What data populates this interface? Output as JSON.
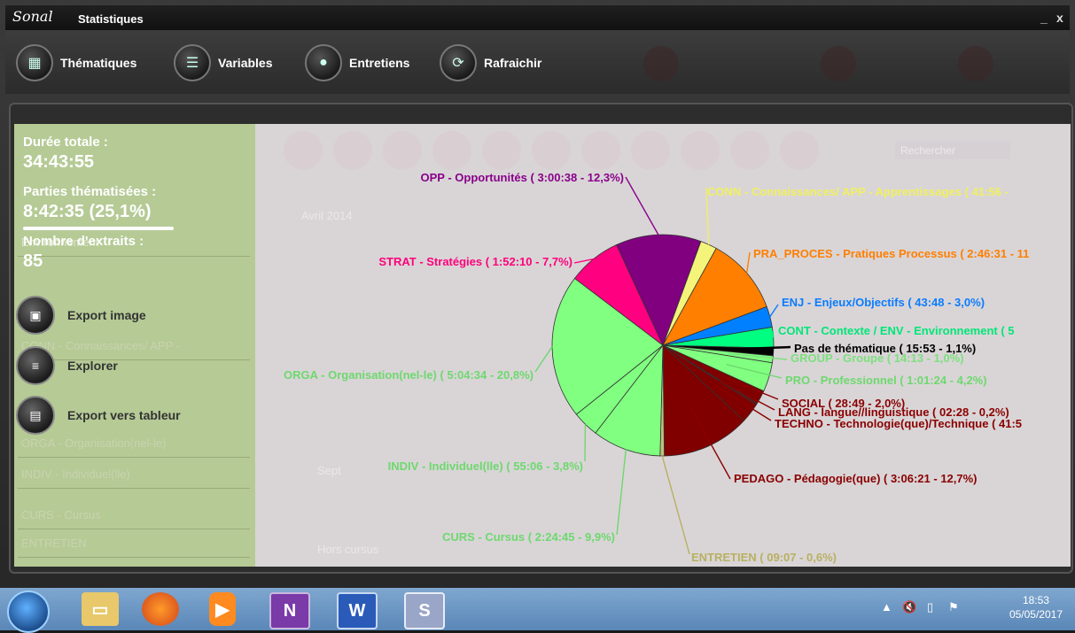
{
  "app": {
    "logo": "Sonal",
    "title": "Statistiques",
    "minimize": "_",
    "close": "x"
  },
  "toolbar": {
    "thematiques": "Thématiques",
    "variables": "Variables",
    "entretiens": "Entretiens",
    "rafraichir": "Rafraichir"
  },
  "stats": {
    "duree_label": "Durée totale :",
    "duree_value": "34:43:55",
    "parties_label": "Parties thématisées :",
    "parties_value": "8:42:35 (25,1%)",
    "extraits_label": "Nombre d'extraits :",
    "extraits_value": "85"
  },
  "actions": {
    "export_image": "Export image",
    "explorer": "Explorer",
    "export_tableur": "Export vers tableur"
  },
  "background_list": {
    "items": [
      "Environnement",
      "CONN - Connaissances/ APP -",
      "ORGA - Organisation(nel-le)",
      "INDIV - Individuel(lle)",
      "CURS - Cursus",
      "ENTRETIEN"
    ],
    "right_items": [
      "Avril 2014",
      "Sept",
      "Hors cursus",
      "Rechercher"
    ]
  },
  "chart_data": {
    "type": "pie",
    "slices": [
      {
        "label": "CONN - Connaissances/ APP - Apprentissages ( 41:56 -",
        "pct": 2.4,
        "color": "#f4f47a",
        "textcolor": "#f0f060"
      },
      {
        "label": "PRA_PROCES - Pratiques Processus ( 2:46:31 - 11",
        "pct": 11.2,
        "color": "#ff8000",
        "textcolor": "#ff7f00"
      },
      {
        "label": "ENJ - Enjeux/Objectifs ( 43:48 - 3,0%)",
        "pct": 3.0,
        "color": "#0080ff",
        "textcolor": "#0a7cff"
      },
      {
        "label": "CONT - Contexte / ENV - Environnement ( 5",
        "pct": 3.0,
        "color": "#00ff80",
        "textcolor": "#00e676"
      },
      {
        "label": "Pas de thématique ( 15:53 - 1,1%)",
        "pct": 1.1,
        "color": "#000000",
        "textcolor": "#000000"
      },
      {
        "label": "GROUP - Groupe ( 14:13 - 1,0%)",
        "pct": 1.0,
        "color": "#80ff80",
        "textcolor": "#7de07d"
      },
      {
        "label": "PRO - Professionnel  ( 1:01:24 - 4,2%)",
        "pct": 4.2,
        "color": "#80ff80",
        "textcolor": "#6ed86e"
      },
      {
        "label": "SOCIAL ( 28:49 - 2,0%)",
        "pct": 2.0,
        "color": "#800000",
        "textcolor": "#8a0000"
      },
      {
        "label": "LANG - langue//linguistique ( 02:28 - 0,2%)",
        "pct": 0.2,
        "color": "#800000",
        "textcolor": "#8a0000"
      },
      {
        "label": "TECHNO - Technologie(que)/Technique ( 41:5",
        "pct": 2.9,
        "color": "#800000",
        "textcolor": "#8a0000"
      },
      {
        "label": "PEDAGO - Pédagogie(que) ( 3:06:21 - 12,7%)",
        "pct": 12.7,
        "color": "#800000",
        "textcolor": "#8a0000"
      },
      {
        "label": "ENTRETIEN ( 09:07 - 0,6%)",
        "pct": 0.6,
        "color": "#c0c080",
        "textcolor": "#b8b060"
      },
      {
        "label": "CURS - Cursus ( 2:24:45 - 9,9%)",
        "pct": 9.9,
        "color": "#80ff80",
        "textcolor": "#6ed86e"
      },
      {
        "label": "INDIV - Individuel(lle) ( 55:06 - 3,8%)",
        "pct": 3.8,
        "color": "#80ff80",
        "textcolor": "#6ed86e"
      },
      {
        "label": "ORGA - Organisation(nel-le) ( 5:04:34 - 20,8%)",
        "pct": 20.8,
        "color": "#80ff80",
        "textcolor": "#6ed86e"
      },
      {
        "label": "STRAT - Stratégies ( 1:52:10 - 7,7%)",
        "pct": 7.7,
        "color": "#ff0080",
        "textcolor": "#ff007a"
      },
      {
        "label": "OPP - Opportunités ( 3:00:38 - 12,3%)",
        "pct": 12.3,
        "color": "#800080",
        "textcolor": "#8a008a"
      }
    ]
  },
  "taskbar": {
    "clock_time": "18:53",
    "clock_date": "05/05/2017",
    "onenote": "N",
    "word": "W"
  }
}
